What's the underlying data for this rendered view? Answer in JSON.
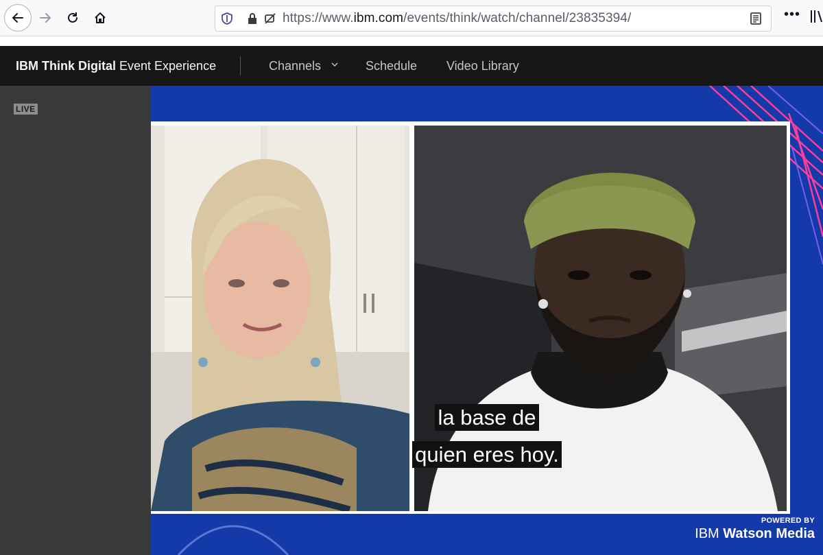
{
  "browser": {
    "url_prefix": "https://www.",
    "url_domain": "ibm.com",
    "url_path": "/events/think/watch/channel/23835394/",
    "icons": [
      "back-arrow-icon",
      "forward-arrow-icon",
      "reload-icon",
      "home-icon",
      "shield-icon",
      "lock-icon",
      "permissions-icon",
      "reader-view-icon",
      "more-icon",
      "library-icon"
    ]
  },
  "header": {
    "brand_bold": "IBM Think Digital",
    "brand_rest": " Event Experience",
    "nav": {
      "channels": "Channels",
      "schedule": "Schedule",
      "library": "Video Library"
    }
  },
  "player": {
    "live_label": "LIVE",
    "caption_line1": "la base de",
    "caption_line2": "quien eres hoy.",
    "powered_by": "POWERED BY",
    "brand_ibm": "IBM",
    "brand_watson": "Watson Media"
  },
  "colors": {
    "header_bg": "#161616",
    "sidebar_bg": "#393939",
    "video_bg": "#1439a8",
    "stripe_accent": "#ff3d9a"
  }
}
